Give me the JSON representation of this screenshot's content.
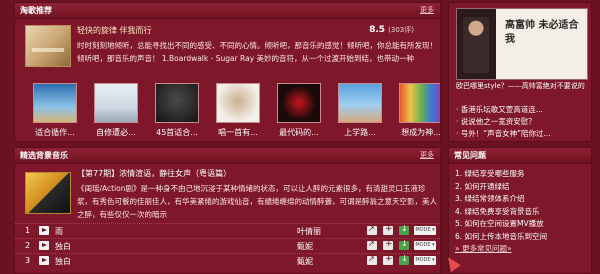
{
  "featured": {
    "section_title": "淘歌推荐",
    "more": "更多",
    "song_title": "轻快的旋律 伴我而行",
    "score": "8.5",
    "score_count": "(303评)",
    "desc": "时时刻刻地倾听，总能寻找出不同的感受、不同的心情。倾听吧，那音乐的感觉！倾听吧，你总能有所发现！倾听吧，那音乐的声音！ 1.Boardwalk - Sugar Ray 美妙的音符，从一个过渡开始到结，也带动一种",
    "albums": [
      {
        "caption": "适合循作..."
      },
      {
        "caption": "自修遭必..."
      },
      {
        "caption": "45首适合..."
      },
      {
        "caption": "唱一首有..."
      },
      {
        "caption": "最代码的..."
      },
      {
        "caption": "上学路..."
      },
      {
        "caption": "想成为神..."
      }
    ]
  },
  "music": {
    "section_title": "精选背景音乐",
    "more": "更多",
    "issue_title": "【第77期】浓情渲语，静往女声（粤语篇）",
    "desc": "《闺瑶/Action剧》是一种身不由己地沉浸于某种情绪的状态，可以让人醉的元素很多，有清甜灵口玉液珍浆，有秀色可餐的佳丽佳人，有华美紧绻的游戏仙音，有缱绻缠绵的动情醉聋，可谓是醉翁之意天空影，美人之醉，有些仅仅一次的暗示",
    "tracks": [
      {
        "num": "1",
        "song": "雨",
        "artist": "叶倩丽",
        "mode": "MODE ▾"
      },
      {
        "num": "2",
        "song": "独白",
        "artist": "甄妮",
        "mode": "MODE ▾"
      },
      {
        "num": "3",
        "song": "独白",
        "artist": "甄妮",
        "mode": "MODE ▾"
      }
    ]
  },
  "right": {
    "promo_hand": "高富帅 未必适合我",
    "promo_caption": "欧巴哪里style？——高帅富绝对不要说的",
    "promo_caption_dim": "",
    "news": [
      "· 香港乐坛歌又萱高道连...",
      "· 说说他之一宽资安慰？",
      "· 号外！“声音女神”陪你过..."
    ]
  },
  "faq": {
    "section_title": "常见问题",
    "items": [
      "1. 绿结享受哪些服务",
      "2. 如何开通绿结",
      "3. 绿结常领体系介绍",
      "4. 绿结免费享受背景音乐",
      "5. 如何在空间设置MV播放",
      "6. 如何上传本地音乐到空间"
    ],
    "more_all": "» 更多常见问题»"
  },
  "colors": {
    "accent": "#6a1220",
    "panel": "#7d1729"
  }
}
